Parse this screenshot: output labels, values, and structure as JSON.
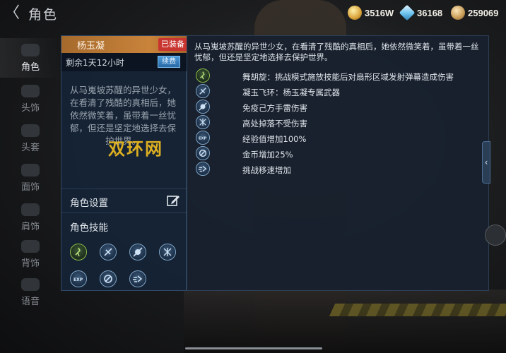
{
  "header": {
    "back_glyph": "〈",
    "title": "角色",
    "currencies": [
      {
        "name": "gold",
        "value": "3516W",
        "color": "#d8a23a"
      },
      {
        "name": "diamond",
        "value": "36168",
        "color": "#6bc3ef"
      },
      {
        "name": "coin",
        "value": "259069",
        "color": "#c69a55"
      }
    ]
  },
  "sidebar": {
    "items": [
      {
        "label": "角色",
        "icon": "character-icon",
        "active": true
      },
      {
        "label": "头饰",
        "icon": "headwear-icon"
      },
      {
        "label": "头套",
        "icon": "hood-icon"
      },
      {
        "label": "面饰",
        "icon": "face-accessory-icon"
      },
      {
        "label": "肩饰",
        "icon": "shoulder-icon"
      },
      {
        "label": "背饰",
        "icon": "back-accessory-icon"
      },
      {
        "label": "语音",
        "icon": "voice-icon"
      }
    ]
  },
  "character": {
    "name": "杨玉凝",
    "status": "已装备",
    "time_left": "剩余1天12小时",
    "renew_label": "续费",
    "description": "从马嵬坡苏醒的异世少女，在看清了残酷的真相后，她依然微笑着，虽带着一丝忧郁，但还是坚定地选择去保护世界。",
    "settings_label": "角色设置",
    "skills_label": "角色技能"
  },
  "watermark": "双环网",
  "detail": {
    "description": "从马嵬坡苏醒的异世少女，在看清了残酷的真相后，她依然微笑着，虽带着一丝忧郁，但还是坚定地选择去保护世界。",
    "skills": [
      {
        "icon": "dance-icon",
        "text": "舞胡旋：挑战模式施放技能后对扇形区域发射弹幕造成伤害",
        "color": "#8dbf4a"
      },
      {
        "icon": "jade-ring-icon",
        "text": "凝玉飞环：杨玉凝专属武器",
        "color": "#7fa6c8"
      },
      {
        "icon": "no-mine-icon",
        "text": "免疫己方手雷伤害",
        "color": "#7fa6c8"
      },
      {
        "icon": "no-fall-icon",
        "text": "高处掉落不受伤害",
        "color": "#7fa6c8"
      },
      {
        "icon": "exp-icon",
        "text": "经验值增加100%",
        "color": "#7fa6c8"
      },
      {
        "icon": "coin-boost-icon",
        "text": "金币增加25%",
        "color": "#7fa6c8"
      },
      {
        "icon": "speed-icon",
        "text": "挑战移速增加",
        "color": "#7fa6c8"
      }
    ]
  }
}
